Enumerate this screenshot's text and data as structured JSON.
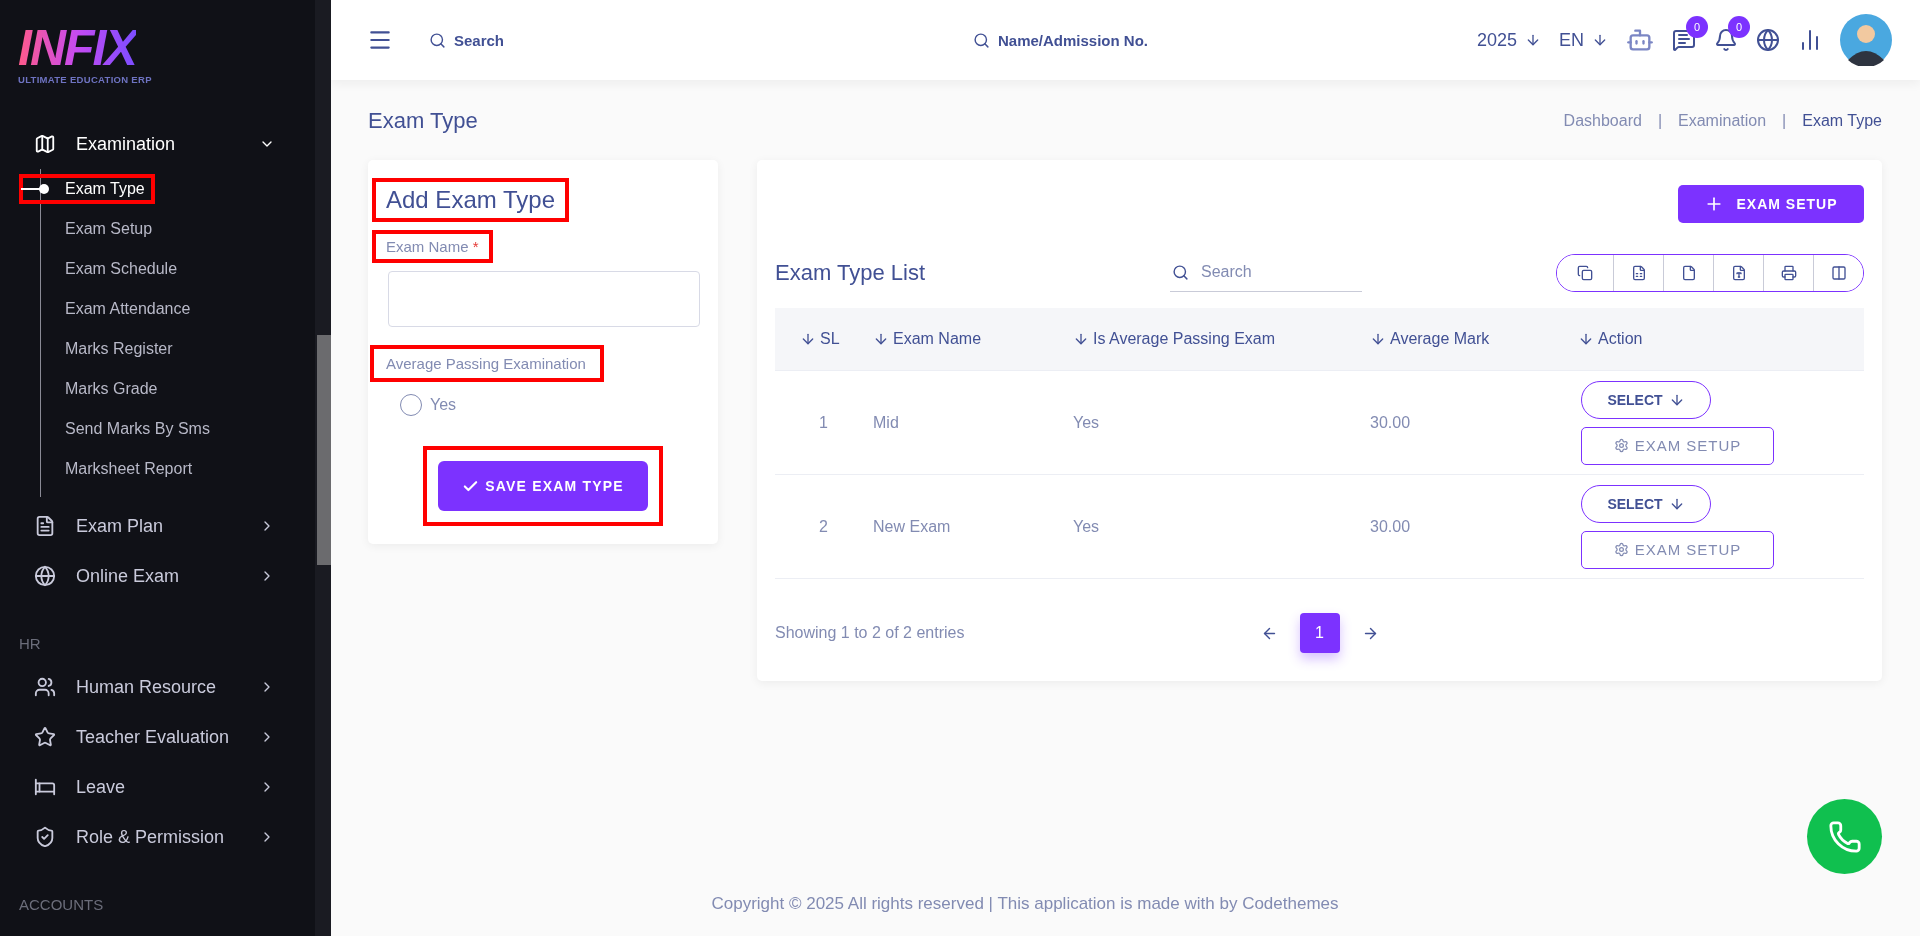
{
  "sidebar": {
    "logo": {
      "brand": "INFIX",
      "tagline": "ULTIMATE EDUCATION ERP"
    },
    "menu": [
      {
        "label": "Examination",
        "expanded": true,
        "children": [
          {
            "label": "Exam Type",
            "selected": true,
            "highlighted": true
          },
          {
            "label": "Exam Setup",
            "selected": false,
            "highlighted": false
          },
          {
            "label": "Exam Schedule",
            "selected": false,
            "highlighted": false
          },
          {
            "label": "Exam Attendance",
            "selected": false,
            "highlighted": false
          },
          {
            "label": "Marks Register",
            "selected": false,
            "highlighted": false
          },
          {
            "label": "Marks Grade",
            "selected": false,
            "highlighted": false
          },
          {
            "label": "Send Marks By Sms",
            "selected": false,
            "highlighted": false
          },
          {
            "label": "Marksheet Report",
            "selected": false,
            "highlighted": false
          }
        ]
      },
      {
        "label": "Exam Plan",
        "expanded": false
      },
      {
        "label": "Online Exam",
        "expanded": false
      }
    ],
    "groups": [
      {
        "heading": "HR",
        "items": [
          {
            "label": "Human Resource",
            "expanded": false
          },
          {
            "label": "Teacher Evaluation",
            "expanded": false
          },
          {
            "label": "Leave",
            "expanded": false
          },
          {
            "label": "Role & Permission",
            "expanded": false
          }
        ]
      },
      {
        "heading": "ACCOUNTS"
      }
    ]
  },
  "topbar": {
    "search": {
      "placeholder": "Search"
    },
    "student_search": {
      "placeholder": "Name/Admission No."
    },
    "year": "2025",
    "language": "EN",
    "chat_badge": "0",
    "notification_badge": "0"
  },
  "page": {
    "title": "Exam Type",
    "breadcrumbs": [
      {
        "label": "Dashboard",
        "selected": false
      },
      {
        "label": "Examination",
        "selected": false
      },
      {
        "label": "Exam Type",
        "selected": true
      }
    ],
    "separator": "|"
  },
  "form": {
    "title": {
      "text": "Add Exam Type",
      "highlighted": true
    },
    "exam_name": {
      "label": "Exam Name",
      "required": "*",
      "highlighted": true
    },
    "average_passing": {
      "label": "Average Passing Examination",
      "highlighted": true,
      "options": [
        {
          "label": "Yes",
          "checked": false
        }
      ]
    },
    "save_button": {
      "label": "SAVE EXAM TYPE",
      "highlighted": true
    }
  },
  "list": {
    "setup_button": "EXAM SETUP",
    "title": "Exam Type List",
    "search": {
      "placeholder": "Search"
    },
    "columns": [
      "SL",
      "Exam Name",
      "Is Average Passing Exam",
      "Average Mark",
      "Action"
    ],
    "rows": [
      {
        "sl": "1",
        "exam_name": "Mid",
        "is_average": "Yes",
        "average_mark": "30.00",
        "actions": [
          "SELECT",
          "EXAM SETUP"
        ]
      },
      {
        "sl": "2",
        "exam_name": "New Exam",
        "is_average": "Yes",
        "average_mark": "30.00",
        "actions": [
          "SELECT",
          "EXAM SETUP"
        ]
      }
    ],
    "summary": "Showing 1 to 2 of 2 entries",
    "pages": [
      {
        "label": "1",
        "selected": true
      }
    ]
  },
  "footer": "Copyright © 2025 All rights reserved | This application is made with by Codethemes"
}
